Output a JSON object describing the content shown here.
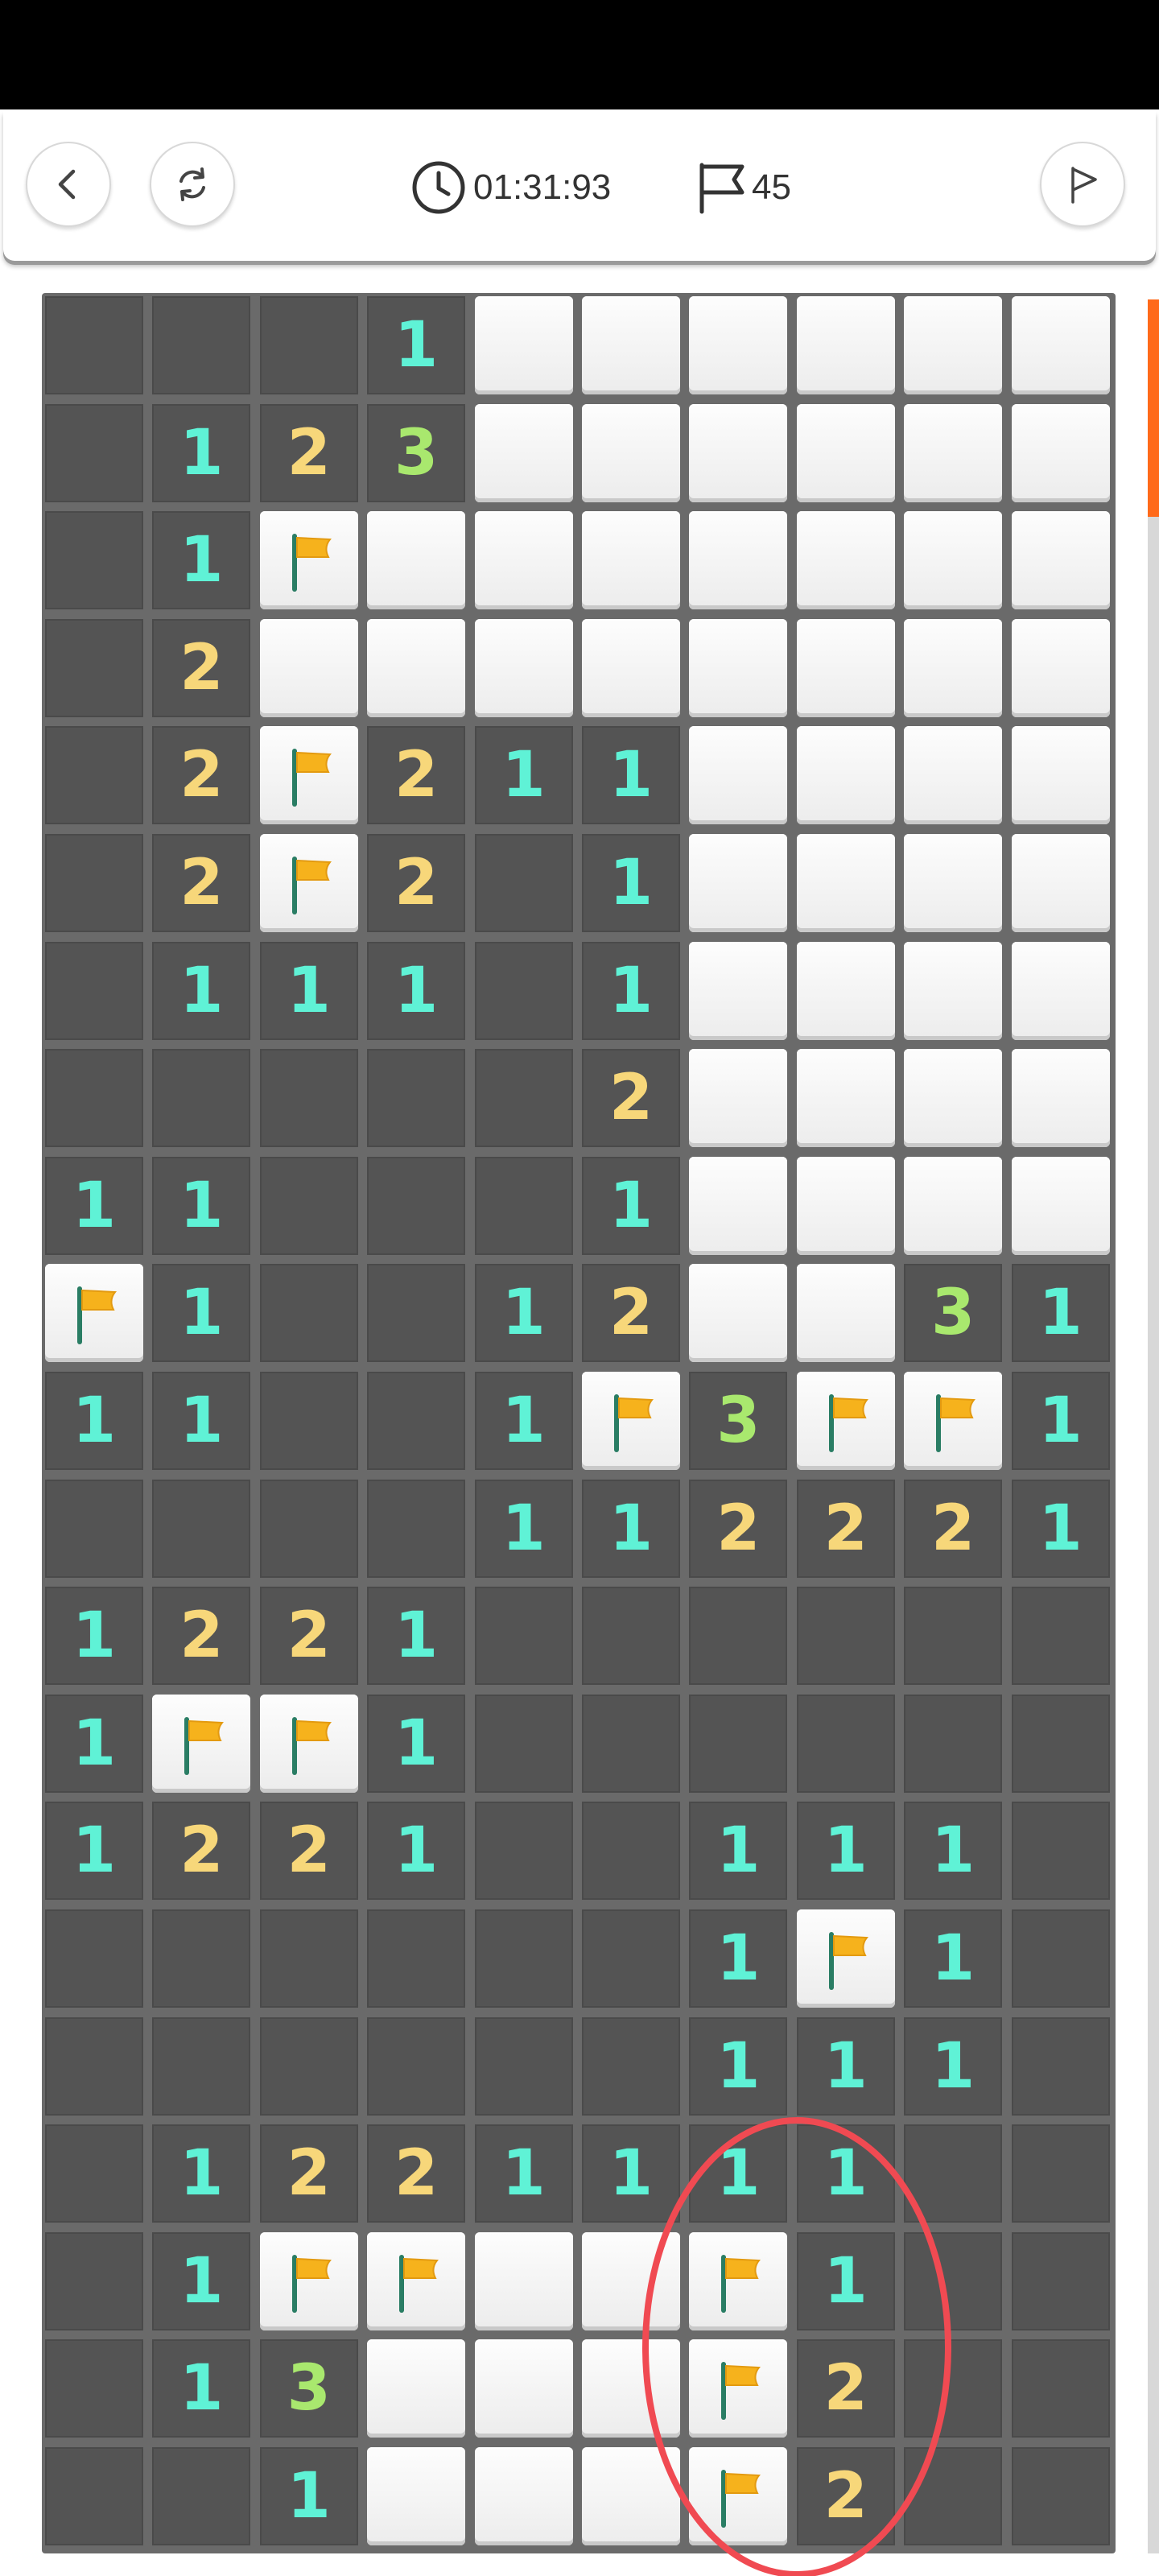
{
  "toolbar": {
    "back_icon": "chevron-left-icon",
    "restart_icon": "restart-arrows-icon",
    "timer_icon": "clock-icon",
    "timer": "01:31:93",
    "flag_icon": "flag-outline-icon",
    "flags_count": "45",
    "flag_mode_icon": "flag-mode-icon"
  },
  "colors": {
    "one": "#5ff2d6",
    "two": "#f7d77a",
    "three": "#a9e86e",
    "flag": "#f6b21c",
    "revealed": "#545454",
    "hidden": "#f5f5f5",
    "annotation": "#f04a52",
    "scroll": "#ff6a1a"
  },
  "board": {
    "rows": [
      [
        "0",
        "0",
        "0",
        "1",
        "H",
        "H",
        "H",
        "H",
        "H",
        "H"
      ],
      [
        "0",
        "1",
        "2",
        "3",
        "H",
        "H",
        "H",
        "H",
        "H",
        "H"
      ],
      [
        "0",
        "1",
        "F",
        "H",
        "H",
        "H",
        "H",
        "H",
        "H",
        "H"
      ],
      [
        "0",
        "2",
        "H",
        "H",
        "H",
        "H",
        "H",
        "H",
        "H",
        "H"
      ],
      [
        "0",
        "2",
        "F",
        "2",
        "1",
        "1",
        "H",
        "H",
        "H",
        "H"
      ],
      [
        "0",
        "2",
        "F",
        "2",
        "0",
        "1",
        "H",
        "H",
        "H",
        "H"
      ],
      [
        "0",
        "1",
        "1",
        "1",
        "0",
        "1",
        "H",
        "H",
        "H",
        "H"
      ],
      [
        "0",
        "0",
        "0",
        "0",
        "0",
        "2",
        "H",
        "H",
        "H",
        "H"
      ],
      [
        "1",
        "1",
        "0",
        "0",
        "0",
        "1",
        "H",
        "H",
        "H",
        "H"
      ],
      [
        "F",
        "1",
        "0",
        "0",
        "1",
        "2",
        "H",
        "H",
        "3",
        "1"
      ],
      [
        "1",
        "1",
        "0",
        "0",
        "1",
        "F",
        "3",
        "F",
        "F",
        "1"
      ],
      [
        "0",
        "0",
        "0",
        "0",
        "1",
        "1",
        "2",
        "2",
        "2",
        "1"
      ],
      [
        "1",
        "2",
        "2",
        "1",
        "0",
        "0",
        "0",
        "0",
        "0",
        "0"
      ],
      [
        "1",
        "F",
        "F",
        "1",
        "0",
        "0",
        "0",
        "0",
        "0",
        "0"
      ],
      [
        "1",
        "2",
        "2",
        "1",
        "0",
        "0",
        "1",
        "1",
        "1",
        "0"
      ],
      [
        "0",
        "0",
        "0",
        "0",
        "0",
        "0",
        "1",
        "F",
        "1",
        "0"
      ],
      [
        "0",
        "0",
        "0",
        "0",
        "0",
        "0",
        "1",
        "1",
        "1",
        "0"
      ],
      [
        "0",
        "1",
        "2",
        "2",
        "1",
        "1",
        "1",
        "1",
        "0",
        "0"
      ],
      [
        "0",
        "1",
        "F",
        "F",
        "H",
        "H",
        "F",
        "1",
        "0",
        "0"
      ],
      [
        "0",
        "1",
        "3",
        "H",
        "H",
        "H",
        "F",
        "2",
        "0",
        "0"
      ],
      [
        "0",
        "0",
        "1",
        "H",
        "H",
        "H",
        "F",
        "2",
        "0",
        "0"
      ]
    ]
  }
}
